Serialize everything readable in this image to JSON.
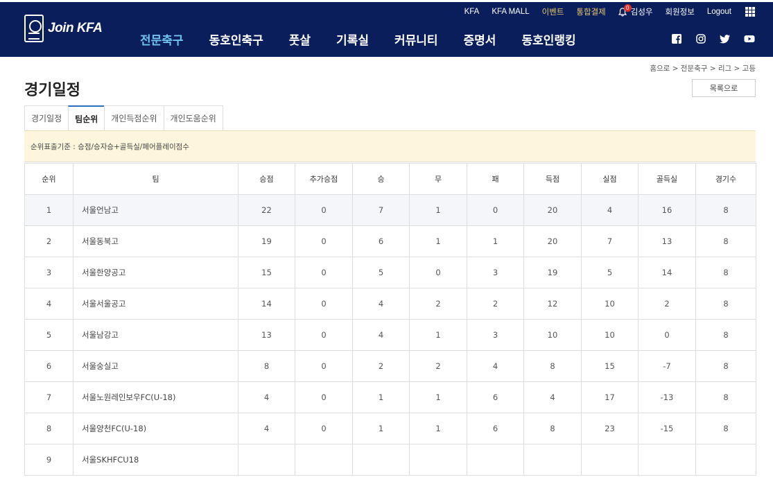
{
  "header": {
    "logo_text": "Join KFA",
    "utility": {
      "kfa": "KFA",
      "kfa_mall": "KFA MALL",
      "event": "이벤트",
      "payment": "통합결제",
      "notification_count": "0",
      "user_name": "김성우",
      "member_info": "회원정보",
      "logout": "Logout"
    },
    "nav": [
      "전문축구",
      "동호인축구",
      "풋살",
      "기록실",
      "커뮤니티",
      "증명서",
      "동호인랭킹"
    ],
    "active_nav": "전문축구",
    "sns_icons": [
      "facebook-icon",
      "instagram-icon",
      "twitter-icon",
      "youtube-icon"
    ],
    "colors": {
      "bar": "#0a1e5c",
      "active_nav": "#6fc3ee",
      "gold": "#e8c86a"
    }
  },
  "breadcrumb": "홈으로 > 전문축구 > 리그 > 고등",
  "page_title": "경기일정",
  "list_button": "목록으로",
  "tabs": [
    "경기일정",
    "팀순위",
    "개인득점순위",
    "개인도움순위"
  ],
  "active_tab": "팀순위",
  "notice": "순위표출기준 : 승점/승자승+골득실/페어플레이점수",
  "table": {
    "headers": [
      "순위",
      "팀",
      "승점",
      "추가승점",
      "승",
      "무",
      "패",
      "득점",
      "실점",
      "골득실",
      "경기수"
    ],
    "rows": [
      [
        "1",
        "서울언남고",
        "22",
        "0",
        "7",
        "1",
        "0",
        "20",
        "4",
        "16",
        "8"
      ],
      [
        "2",
        "서울동북고",
        "19",
        "0",
        "6",
        "1",
        "1",
        "20",
        "7",
        "13",
        "8"
      ],
      [
        "3",
        "서울한양공고",
        "15",
        "0",
        "5",
        "0",
        "3",
        "19",
        "5",
        "14",
        "8"
      ],
      [
        "4",
        "서울서울공고",
        "14",
        "0",
        "4",
        "2",
        "2",
        "12",
        "10",
        "2",
        "8"
      ],
      [
        "5",
        "서울남강고",
        "13",
        "0",
        "4",
        "1",
        "3",
        "10",
        "10",
        "0",
        "8"
      ],
      [
        "6",
        "서울숭실고",
        "8",
        "0",
        "2",
        "2",
        "4",
        "8",
        "15",
        "-7",
        "8"
      ],
      [
        "7",
        "서울노원레인보우FC(U-18)",
        "4",
        "0",
        "1",
        "1",
        "6",
        "4",
        "17",
        "-13",
        "8"
      ],
      [
        "8",
        "서울양천FC(U-18)",
        "4",
        "0",
        "1",
        "1",
        "6",
        "8",
        "23",
        "-15",
        "8"
      ],
      [
        "9",
        "서울SKHFCU18",
        "",
        "",
        "",
        "",
        "",
        "",
        "",
        "",
        ""
      ]
    ]
  }
}
